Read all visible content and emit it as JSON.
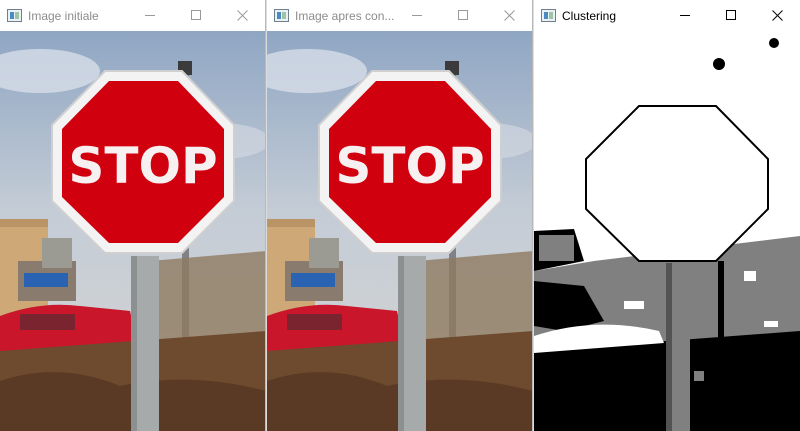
{
  "windows": [
    {
      "title": "Image initiale",
      "active": false
    },
    {
      "title": "Image apres con...",
      "active": false
    },
    {
      "title": "Clustering",
      "active": true
    }
  ],
  "sign_text": "STOP",
  "colors": {
    "sign_red": "#d0000f",
    "sign_border": "#f3f3f3",
    "sky": "#b9c5d3",
    "car_red": "#c9162a",
    "pole": "#a7aaab"
  },
  "icons": [
    "app-icon",
    "minimize-icon",
    "maximize-icon",
    "close-icon"
  ]
}
